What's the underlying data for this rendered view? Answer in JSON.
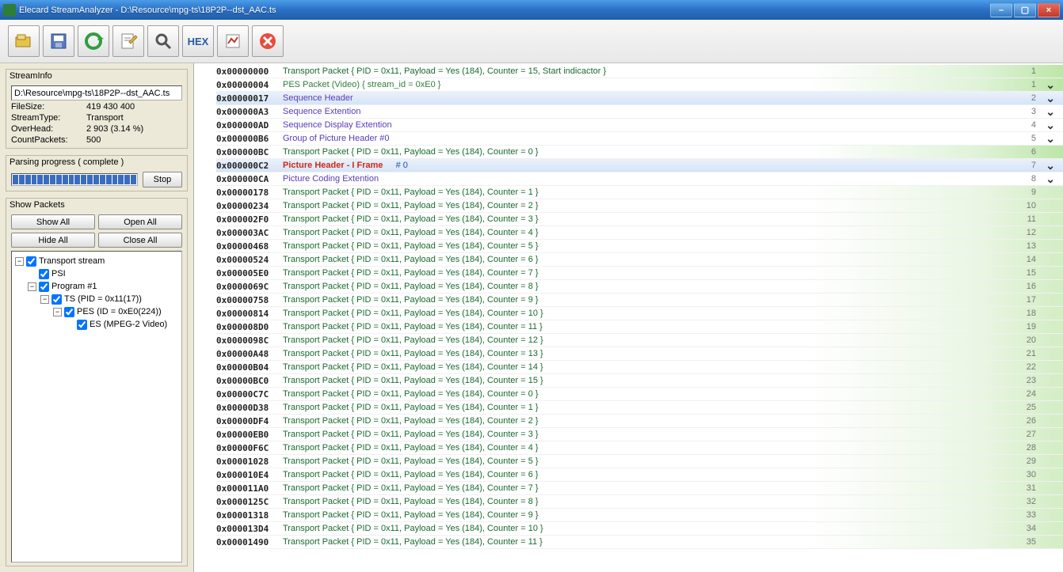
{
  "window": {
    "title": "Elecard StreamAnalyzer - D:\\Resource\\mpg-ts\\18P2P--dst_AAC.ts"
  },
  "toolbar": {
    "open": "open-file",
    "save": "save",
    "refresh": "refresh",
    "edit": "edit-note",
    "search": "search",
    "hex": "HEX",
    "report": "report",
    "close": "close"
  },
  "streaminfo": {
    "panel_title": "StreamInfo",
    "path": "D:\\Resource\\mpg-ts\\18P2P--dst_AAC.ts",
    "rows": {
      "filesize_k": "FileSize:",
      "filesize_v": "419 430 400",
      "streamtype_k": "StreamType:",
      "streamtype_v": "Transport",
      "overhead_k": "OverHead:",
      "overhead_v": "2 903 (3.14 %)",
      "count_k": "CountPackets:",
      "count_v": "500"
    }
  },
  "parsing": {
    "title": "Parsing progress ( complete )",
    "stop": "Stop"
  },
  "showpackets": {
    "title": "Show Packets",
    "show_all": "Show All",
    "open_all": "Open All",
    "hide_all": "Hide All",
    "close_all": "Close All"
  },
  "tree": {
    "n0": "Transport stream",
    "n1": "PSI",
    "n2": "Program  #1",
    "n3": "TS (PID = 0x11(17))",
    "n4": "PES (ID = 0xE0(224))",
    "n5": "ES (MPEG-2 Video)"
  },
  "rows": [
    {
      "addr": "0x00000000",
      "text": "Transport Packet { PID = 0x11, Payload = Yes (184), Counter = 15, Start indicactor }",
      "num": "1",
      "cls": "c-dgreen",
      "bg": "greengrad",
      "exp": false
    },
    {
      "addr": "0x00000004",
      "text": "PES Packet (Video) { stream_id = 0xE0  }",
      "num": "1",
      "cls": "c-green",
      "bg": "greengrad",
      "exp": true
    },
    {
      "addr": "0x00000017",
      "text": "Sequence Header",
      "num": "2",
      "cls": "c-purple",
      "bg": "bluestripe",
      "exp": true
    },
    {
      "addr": "0x000000A3",
      "text": "Sequence Extention",
      "num": "3",
      "cls": "c-purple",
      "bg": "whitebg",
      "exp": true
    },
    {
      "addr": "0x000000AD",
      "text": "Sequence Display Extention",
      "num": "4",
      "cls": "c-purple",
      "bg": "whitebg",
      "exp": true
    },
    {
      "addr": "0x000000B6",
      "text": "Group of Picture Header #0",
      "num": "5",
      "cls": "c-purple",
      "bg": "whitebg",
      "exp": true
    },
    {
      "addr": "0x000000BC",
      "text": "Transport Packet { PID = 0x11, Payload = Yes (184), Counter = 0 }",
      "num": "6",
      "cls": "c-dgreen",
      "bg": "greengrad",
      "exp": false
    },
    {
      "addr": "0x000000C2",
      "text": "Picture Header - I Frame",
      "extra": "# 0",
      "num": "7",
      "cls": "c-red",
      "bg": "bluestripe",
      "exp": true
    },
    {
      "addr": "0x000000CA",
      "text": "Picture Coding Extention",
      "num": "8",
      "cls": "c-purple",
      "bg": "whitebg",
      "exp": true
    },
    {
      "addr": "0x00000178",
      "text": "Transport Packet { PID = 0x11, Payload = Yes (184), Counter = 1 }",
      "num": "9",
      "cls": "c-dgreen",
      "bg": "lightgrad",
      "exp": false
    },
    {
      "addr": "0x00000234",
      "text": "Transport Packet { PID = 0x11, Payload = Yes (184), Counter = 2 }",
      "num": "10",
      "cls": "c-dgreen",
      "bg": "lightgrad",
      "exp": false
    },
    {
      "addr": "0x000002F0",
      "text": "Transport Packet { PID = 0x11, Payload = Yes (184), Counter = 3 }",
      "num": "11",
      "cls": "c-dgreen",
      "bg": "lightgrad",
      "exp": false
    },
    {
      "addr": "0x000003AC",
      "text": "Transport Packet { PID = 0x11, Payload = Yes (184), Counter = 4 }",
      "num": "12",
      "cls": "c-dgreen",
      "bg": "lightgrad",
      "exp": false
    },
    {
      "addr": "0x00000468",
      "text": "Transport Packet { PID = 0x11, Payload = Yes (184), Counter = 5 }",
      "num": "13",
      "cls": "c-dgreen",
      "bg": "lightgrad",
      "exp": false
    },
    {
      "addr": "0x00000524",
      "text": "Transport Packet { PID = 0x11, Payload = Yes (184), Counter = 6 }",
      "num": "14",
      "cls": "c-dgreen",
      "bg": "lightgrad",
      "exp": false
    },
    {
      "addr": "0x000005E0",
      "text": "Transport Packet { PID = 0x11, Payload = Yes (184), Counter = 7 }",
      "num": "15",
      "cls": "c-dgreen",
      "bg": "lightgrad",
      "exp": false
    },
    {
      "addr": "0x0000069C",
      "text": "Transport Packet { PID = 0x11, Payload = Yes (184), Counter = 8 }",
      "num": "16",
      "cls": "c-dgreen",
      "bg": "lightgrad",
      "exp": false
    },
    {
      "addr": "0x00000758",
      "text": "Transport Packet { PID = 0x11, Payload = Yes (184), Counter = 9 }",
      "num": "17",
      "cls": "c-dgreen",
      "bg": "lightgrad",
      "exp": false
    },
    {
      "addr": "0x00000814",
      "text": "Transport Packet { PID = 0x11, Payload = Yes (184), Counter = 10 }",
      "num": "18",
      "cls": "c-dgreen",
      "bg": "lightgrad",
      "exp": false
    },
    {
      "addr": "0x000008D0",
      "text": "Transport Packet { PID = 0x11, Payload = Yes (184), Counter = 11 }",
      "num": "19",
      "cls": "c-dgreen",
      "bg": "lightgrad",
      "exp": false
    },
    {
      "addr": "0x0000098C",
      "text": "Transport Packet { PID = 0x11, Payload = Yes (184), Counter = 12 }",
      "num": "20",
      "cls": "c-dgreen",
      "bg": "lightgrad",
      "exp": false
    },
    {
      "addr": "0x00000A48",
      "text": "Transport Packet { PID = 0x11, Payload = Yes (184), Counter = 13 }",
      "num": "21",
      "cls": "c-dgreen",
      "bg": "lightgrad",
      "exp": false
    },
    {
      "addr": "0x00000B04",
      "text": "Transport Packet { PID = 0x11, Payload = Yes (184), Counter = 14 }",
      "num": "22",
      "cls": "c-dgreen",
      "bg": "lightgrad",
      "exp": false
    },
    {
      "addr": "0x00000BC0",
      "text": "Transport Packet { PID = 0x11, Payload = Yes (184), Counter = 15 }",
      "num": "23",
      "cls": "c-dgreen",
      "bg": "lightgrad",
      "exp": false
    },
    {
      "addr": "0x00000C7C",
      "text": "Transport Packet { PID = 0x11, Payload = Yes (184), Counter = 0 }",
      "num": "24",
      "cls": "c-dgreen",
      "bg": "lightgrad",
      "exp": false
    },
    {
      "addr": "0x00000D38",
      "text": "Transport Packet { PID = 0x11, Payload = Yes (184), Counter = 1 }",
      "num": "25",
      "cls": "c-dgreen",
      "bg": "lightgrad",
      "exp": false
    },
    {
      "addr": "0x00000DF4",
      "text": "Transport Packet { PID = 0x11, Payload = Yes (184), Counter = 2 }",
      "num": "26",
      "cls": "c-dgreen",
      "bg": "lightgrad",
      "exp": false
    },
    {
      "addr": "0x00000EB0",
      "text": "Transport Packet { PID = 0x11, Payload = Yes (184), Counter = 3 }",
      "num": "27",
      "cls": "c-dgreen",
      "bg": "lightgrad",
      "exp": false
    },
    {
      "addr": "0x00000F6C",
      "text": "Transport Packet { PID = 0x11, Payload = Yes (184), Counter = 4 }",
      "num": "28",
      "cls": "c-dgreen",
      "bg": "lightgrad",
      "exp": false
    },
    {
      "addr": "0x00001028",
      "text": "Transport Packet { PID = 0x11, Payload = Yes (184), Counter = 5 }",
      "num": "29",
      "cls": "c-dgreen",
      "bg": "lightgrad",
      "exp": false
    },
    {
      "addr": "0x000010E4",
      "text": "Transport Packet { PID = 0x11, Payload = Yes (184), Counter = 6 }",
      "num": "30",
      "cls": "c-dgreen",
      "bg": "lightgrad",
      "exp": false
    },
    {
      "addr": "0x000011A0",
      "text": "Transport Packet { PID = 0x11, Payload = Yes (184), Counter = 7 }",
      "num": "31",
      "cls": "c-dgreen",
      "bg": "lightgrad",
      "exp": false
    },
    {
      "addr": "0x0000125C",
      "text": "Transport Packet { PID = 0x11, Payload = Yes (184), Counter = 8 }",
      "num": "32",
      "cls": "c-dgreen",
      "bg": "lightgrad",
      "exp": false
    },
    {
      "addr": "0x00001318",
      "text": "Transport Packet { PID = 0x11, Payload = Yes (184), Counter = 9 }",
      "num": "33",
      "cls": "c-dgreen",
      "bg": "lightgrad",
      "exp": false
    },
    {
      "addr": "0x000013D4",
      "text": "Transport Packet { PID = 0x11, Payload = Yes (184), Counter = 10 }",
      "num": "34",
      "cls": "c-dgreen",
      "bg": "lightgrad",
      "exp": false
    },
    {
      "addr": "0x00001490",
      "text": "Transport Packet { PID = 0x11, Payload = Yes (184), Counter = 11 }",
      "num": "35",
      "cls": "c-dgreen",
      "bg": "lightgrad",
      "exp": false
    }
  ]
}
